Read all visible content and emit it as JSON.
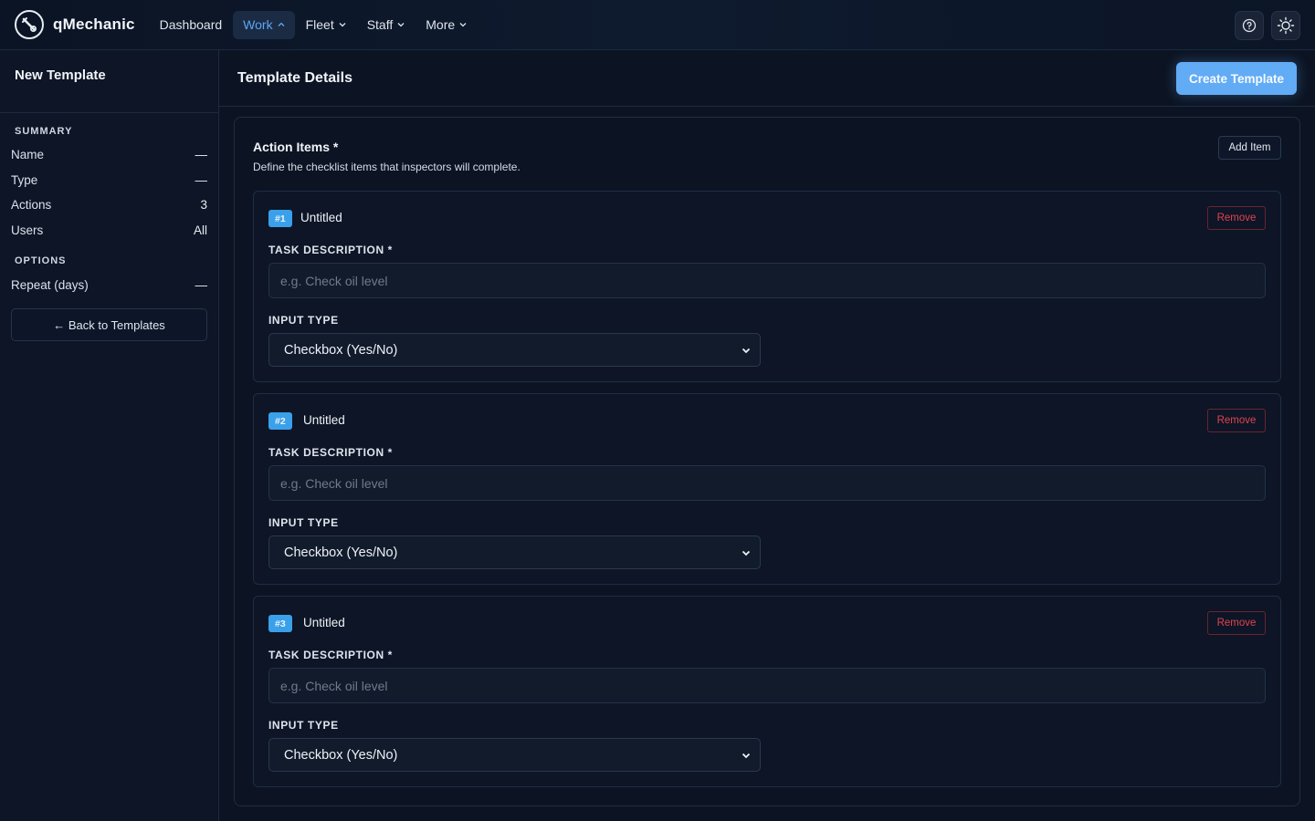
{
  "brand": {
    "name": "qMechanic"
  },
  "nav": {
    "items": [
      {
        "label": "Dashboard",
        "dropdown": false,
        "active": false
      },
      {
        "label": "Work",
        "dropdown": true,
        "active": true
      },
      {
        "label": "Fleet",
        "dropdown": true,
        "active": false
      },
      {
        "label": "Staff",
        "dropdown": true,
        "active": false
      },
      {
        "label": "More",
        "dropdown": true,
        "active": false
      }
    ]
  },
  "sidebar": {
    "title": "New Template",
    "summary_label": "SUMMARY",
    "summary": [
      {
        "key": "Name",
        "value": "—"
      },
      {
        "key": "Type",
        "value": "—"
      },
      {
        "key": "Actions",
        "value": "3"
      },
      {
        "key": "Users",
        "value": "All"
      }
    ],
    "options_label": "OPTIONS",
    "options": [
      {
        "key": "Repeat (days)",
        "value": "—"
      }
    ],
    "back_label": "← Back to Templates"
  },
  "main": {
    "title": "Template Details",
    "create_label": "Create Template"
  },
  "action_items": {
    "title": "Action Items *",
    "subtitle": "Define the checklist items that inspectors will complete.",
    "add_label": "Add Item",
    "items": [
      {
        "badge": "#1",
        "title": "Untitled",
        "remove_label": "Remove",
        "desc_label": "TASK DESCRIPTION *",
        "desc_value": "",
        "desc_placeholder": "e.g. Check oil level",
        "type_label": "INPUT TYPE",
        "type_value": "Checkbox (Yes/No)"
      },
      {
        "badge": "#2",
        "title": "Untitled",
        "remove_label": "Remove",
        "desc_label": "TASK DESCRIPTION *",
        "desc_value": "",
        "desc_placeholder": "e.g. Check oil level",
        "type_label": "INPUT TYPE",
        "type_value": "Checkbox (Yes/No)"
      },
      {
        "badge": "#3",
        "title": "Untitled",
        "remove_label": "Remove",
        "desc_label": "TASK DESCRIPTION *",
        "desc_value": "",
        "desc_placeholder": "e.g. Check oil level",
        "type_label": "INPUT TYPE",
        "type_value": "Checkbox (Yes/No)"
      }
    ]
  },
  "colors": {
    "accent": "#62abf5",
    "badge": "#3aa0ea",
    "danger": "#e0434f",
    "background": "#0c1423"
  },
  "icons": {
    "logo": "wrench-logo-icon",
    "help": "help-circle-icon",
    "theme": "sun-icon",
    "dropdown": "chevron-down-icon",
    "dropdown_open": "chevron-up-icon",
    "select": "chevron-down-icon"
  }
}
